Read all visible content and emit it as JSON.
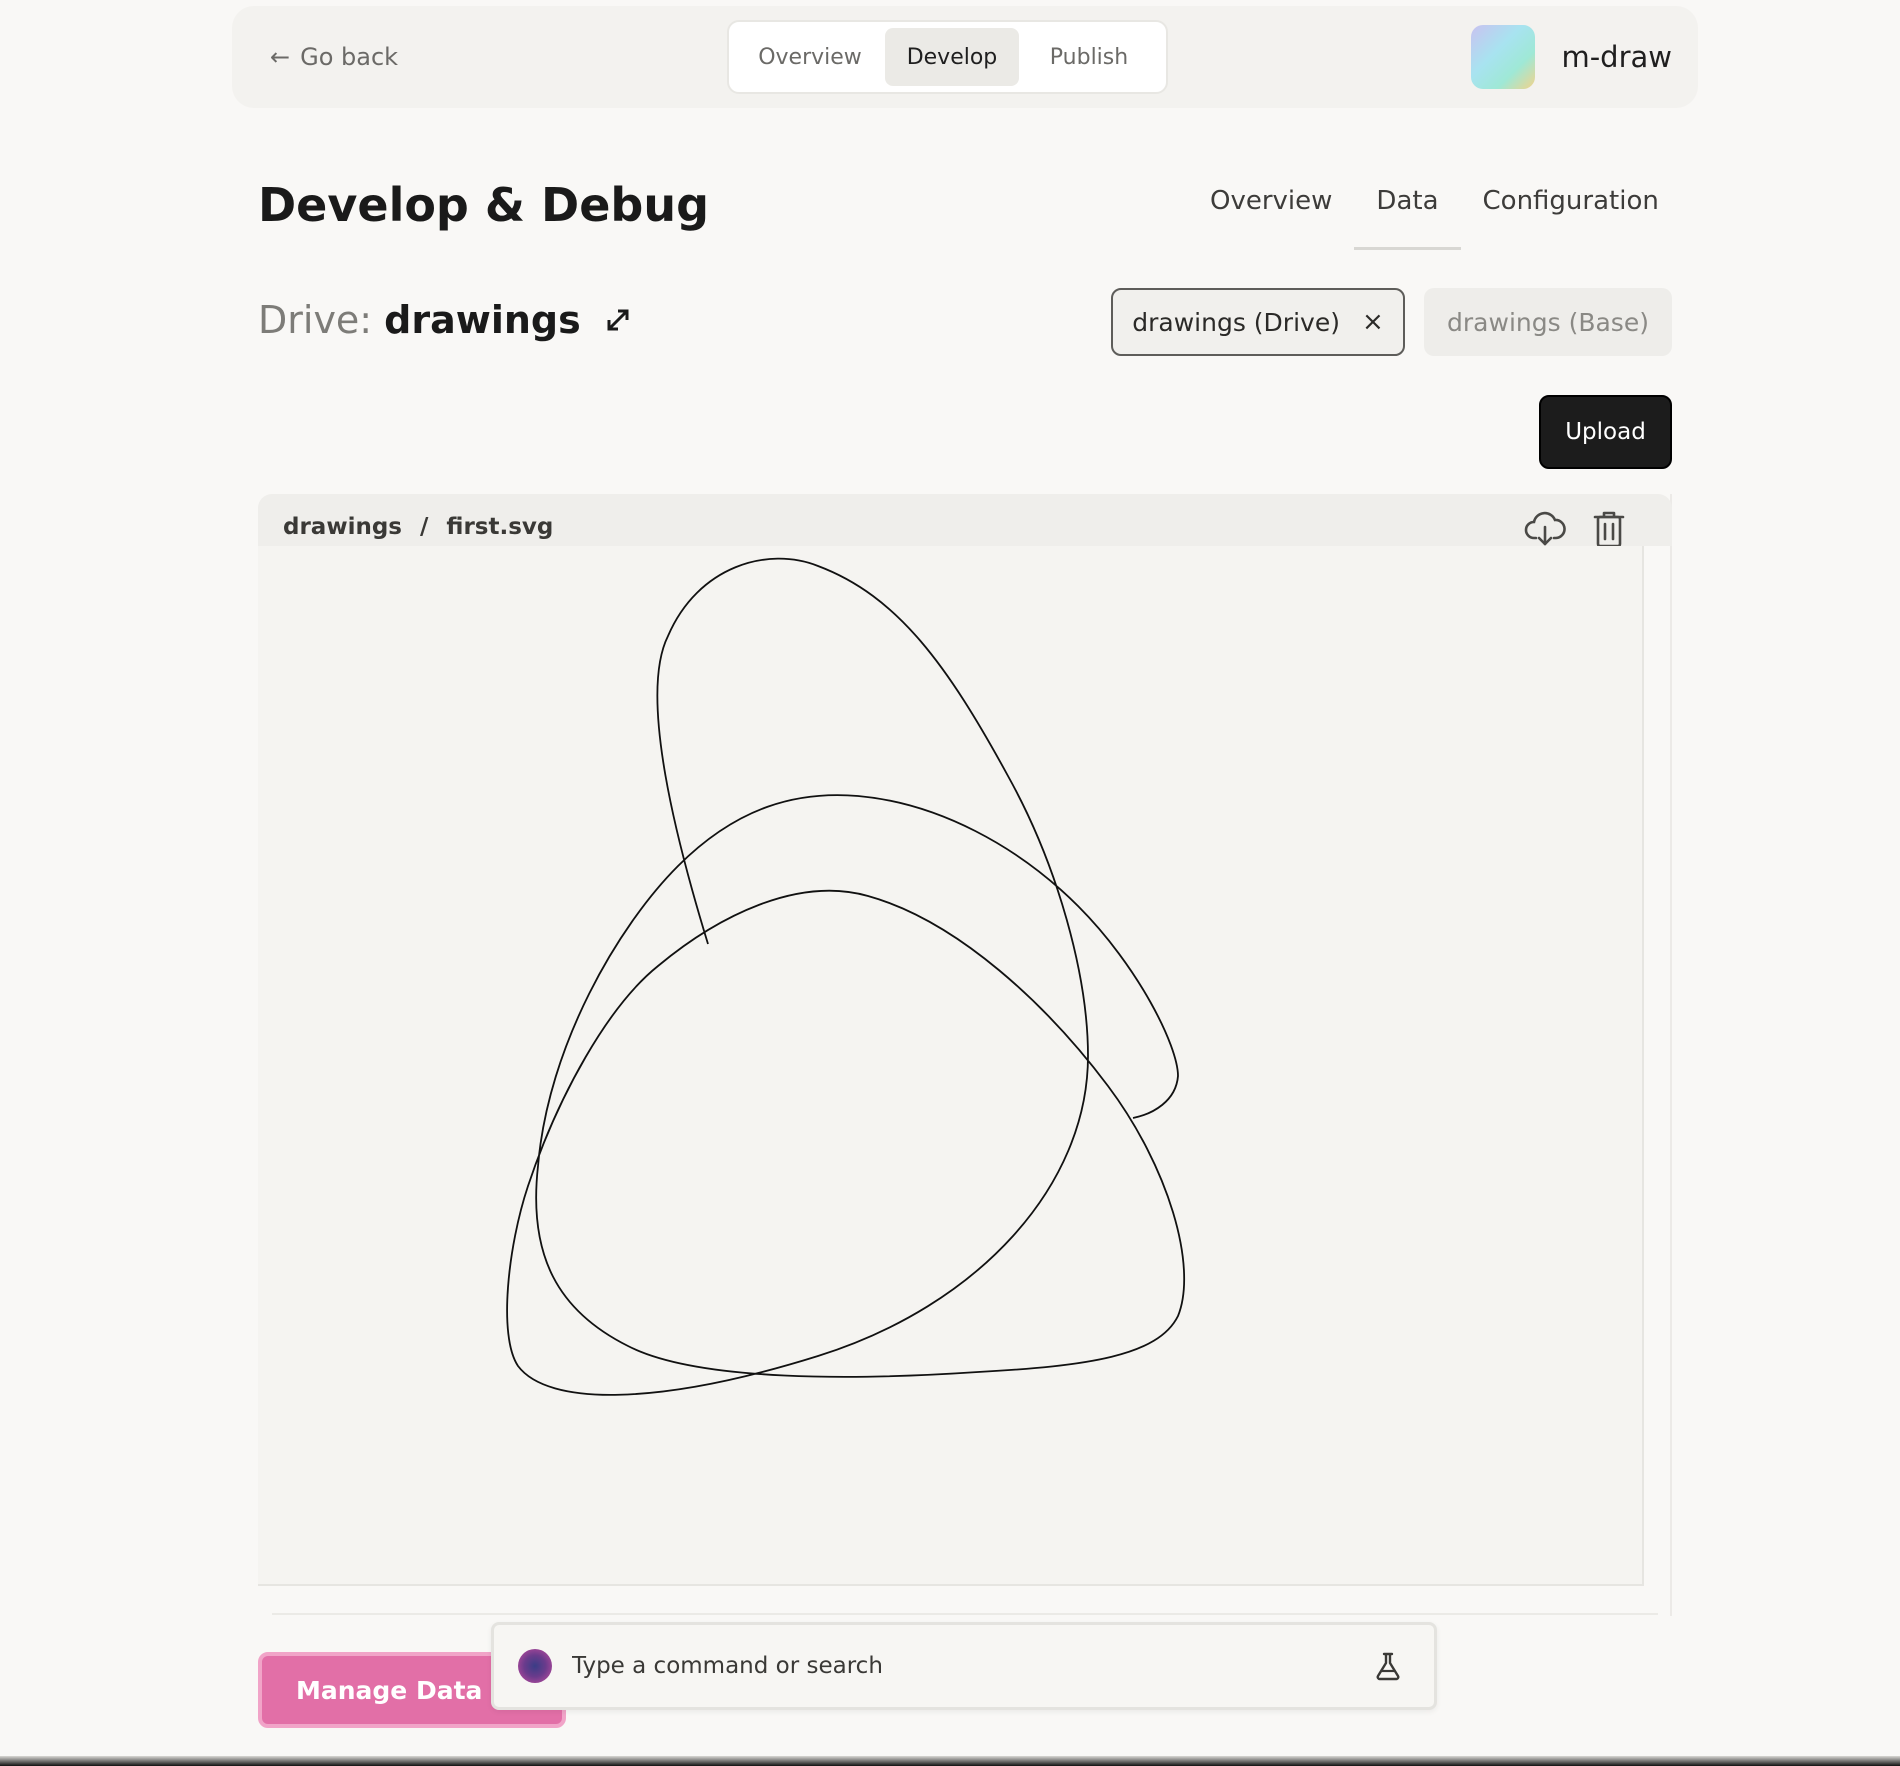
{
  "topbar": {
    "back_label": "Go back",
    "nav_tabs": [
      {
        "label": "Overview",
        "active": false
      },
      {
        "label": "Develop",
        "active": true
      },
      {
        "label": "Publish",
        "active": false
      }
    ],
    "app_name": "m-draw"
  },
  "page": {
    "title": "Develop & Debug",
    "subtabs": [
      {
        "label": "Overview",
        "active": false
      },
      {
        "label": "Data",
        "active": true
      },
      {
        "label": "Configuration",
        "active": false
      }
    ]
  },
  "drive": {
    "prefix": "Drive:",
    "name": "drawings",
    "chips": [
      {
        "label": "drawings (Drive)",
        "active": true
      },
      {
        "label": "drawings (Base)",
        "active": false
      }
    ],
    "close_glyph": "×",
    "upload_label": "Upload"
  },
  "file": {
    "breadcrumb": [
      "drawings",
      "/",
      "first.svg"
    ],
    "actions": [
      "cloud-download-icon",
      "trash-icon"
    ]
  },
  "footer": {
    "manage_label": "Manage Data Keys",
    "command_placeholder": "Type a command or search"
  },
  "colors": {
    "accent_pink": "#e26fa7",
    "upload_bg": "#1c1c1c",
    "page_bg": "#f9f8f6"
  }
}
